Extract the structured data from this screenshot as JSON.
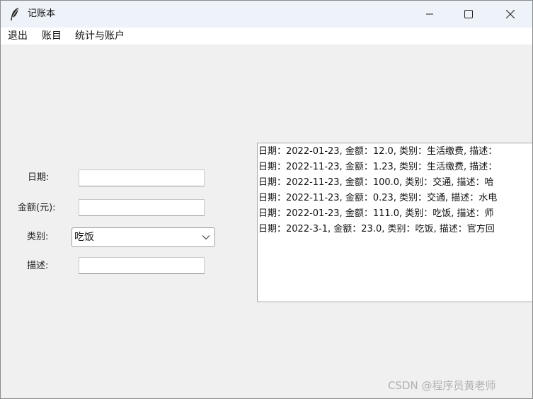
{
  "window": {
    "title": "记账本",
    "icon": "feather-icon",
    "controls": [
      "minimize-icon",
      "maximize-icon",
      "close-icon"
    ]
  },
  "menu": {
    "exit": "退出",
    "accounts": "账目",
    "stats": "统计与账户"
  },
  "form": {
    "date_label": "日期:",
    "amount_label": "金额(元):",
    "category_label": "类别:",
    "category_value": "吃饭",
    "desc_label": "描述:",
    "date_value": "",
    "amount_value": "",
    "desc_value": ""
  },
  "records": [
    "日期：2022-01-23, 金额：12.0, 类别：生活缴费, 描述：",
    "日期：2022-11-23, 金额：1.23, 类别：生活缴费, 描述：",
    "日期：2022-11-23, 金额：100.0, 类别：交通, 描述：哈",
    "日期：2022-11-23, 金额：0.23, 类别：交通, 描述：水电",
    "日期：2022-01-23, 金额：111.0, 类别：吃饭, 描述：师",
    "日期：2022-3-1, 金额：23.0, 类别：吃饭, 描述：官方回"
  ],
  "watermark": "CSDN @程序员黄老师"
}
